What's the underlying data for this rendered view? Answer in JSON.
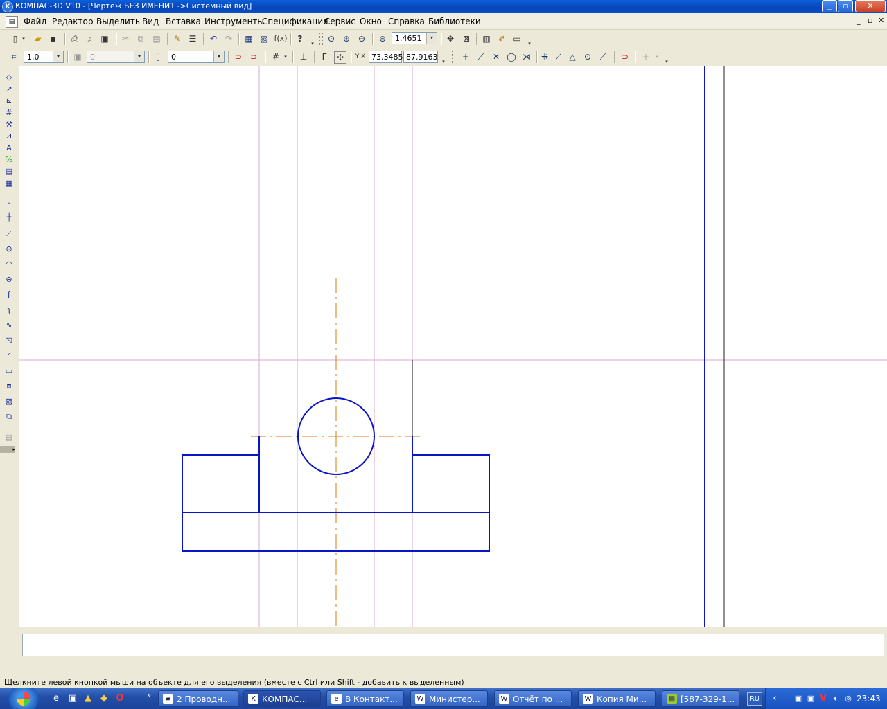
{
  "window": {
    "title": "КОМПАС-3D V10 - [Чертеж БЕЗ ИМЕНИ1 ->Системный вид]",
    "controls": [
      "_",
      "□",
      "✕"
    ]
  },
  "menu": [
    "Файл",
    "Редактор",
    "Выделить",
    "Вид",
    "Вставка",
    "Инструменты",
    "Спецификация",
    "Сервис",
    "Окно",
    "Справка",
    "Библиотеки"
  ],
  "toolbar1": {
    "zoom_value": "1.4651"
  },
  "toolbar2": {
    "step_value": "1.0",
    "layer_value": "0",
    "style_value": "0",
    "coord_x": "73.3485",
    "coord_y": "87.9163",
    "coord_label": "Y X"
  },
  "status": {
    "hint": "Щелкните левой кнопкой мыши на объекте для его выделения (вместе с Ctrl или Shift - добавить к выделенным)"
  },
  "taskbar": {
    "tasks": [
      "2 Проводн...",
      "КОМПАС...",
      "В Контакт...",
      "Министер...",
      "Отчёт по ...",
      "Копия Ми...",
      "[587-329-1..."
    ],
    "language": "RU",
    "clock": "23:43"
  },
  "colors": {
    "contour": "#0a14c8",
    "axis": "#d8780a",
    "aux_line": "#d8a8cc",
    "frame_line": "#1414c8"
  }
}
